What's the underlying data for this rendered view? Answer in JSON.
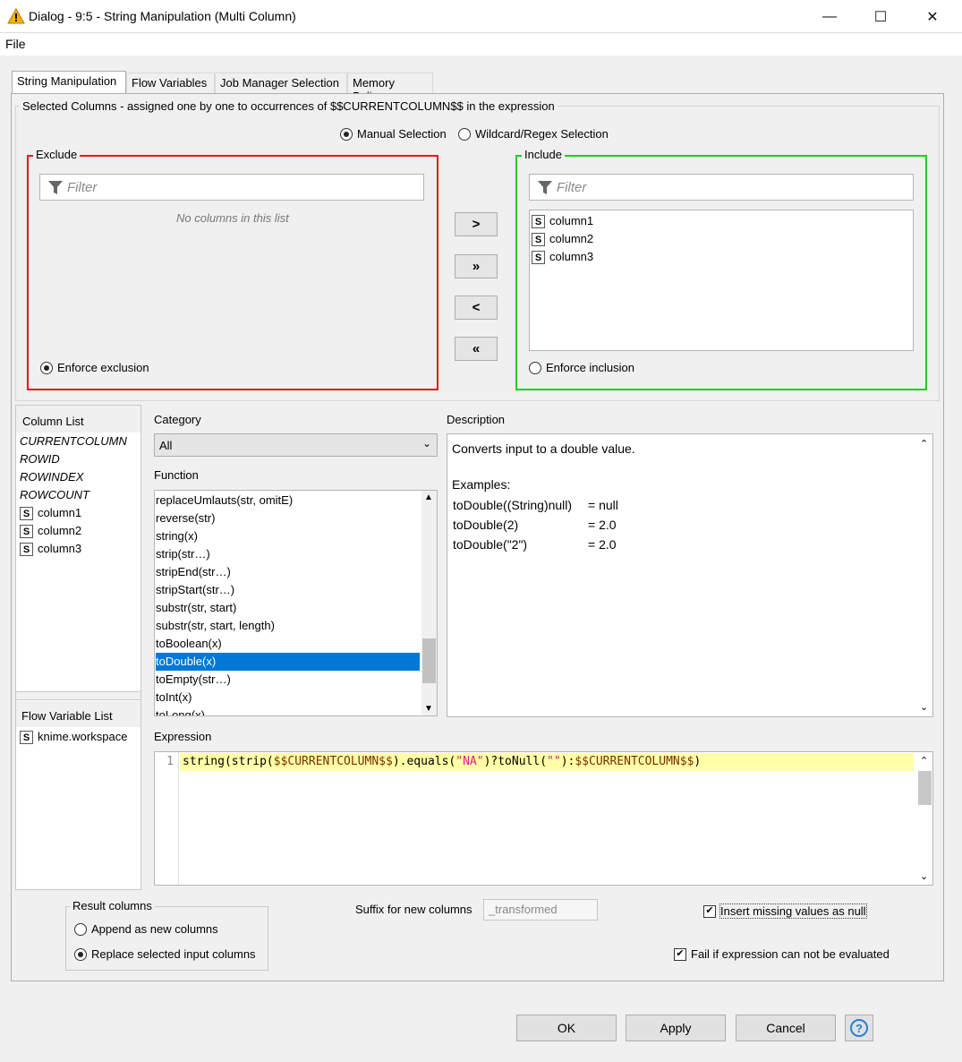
{
  "window": {
    "title": "Dialog - 9:5 - String Manipulation (Multi Column)",
    "min": "—",
    "max": "☐",
    "close": "✕"
  },
  "menu": {
    "file": "File"
  },
  "tabs": [
    "String Manipulation",
    "Flow Variables",
    "Job Manager Selection",
    "Memory Policy"
  ],
  "selected_columns": {
    "legend": "Selected Columns - assigned one by one to occurrences of $$CURRENTCOLUMN$$ in the expression",
    "manual": "Manual Selection",
    "wildcard": "Wildcard/Regex Selection",
    "exclude": {
      "title": "Exclude",
      "filter_placeholder": "Filter",
      "empty": "No columns in this list",
      "enforce": "Enforce exclusion",
      "color": "#e11b1b"
    },
    "include": {
      "title": "Include",
      "filter_placeholder": "Filter",
      "items": [
        "column1",
        "column2",
        "column3"
      ],
      "enforce": "Enforce inclusion",
      "color": "#22cc22"
    },
    "buttons": {
      "add": ">",
      "add_all": "»",
      "remove": "<",
      "remove_all": "«"
    }
  },
  "column_list": {
    "title": "Column List",
    "special": [
      "CURRENTCOLUMN",
      "ROWID",
      "ROWINDEX",
      "ROWCOUNT"
    ],
    "columns": [
      "column1",
      "column2",
      "column3"
    ],
    "type_icon": "S"
  },
  "flow_list": {
    "title": "Flow Variable List",
    "items": [
      "knime.workspace"
    ]
  },
  "category": {
    "label": "Category",
    "value": "All"
  },
  "function": {
    "label": "Function",
    "items": [
      "replaceUmlauts(str, omitE)",
      "reverse(str)",
      "string(x)",
      "strip(str…)",
      "stripEnd(str…)",
      "stripStart(str…)",
      "substr(str, start)",
      "substr(str, start, length)",
      "toBoolean(x)",
      "toDouble(x)",
      "toEmpty(str…)",
      "toInt(x)",
      "toLong(x)"
    ],
    "selected": "toDouble(x)"
  },
  "description": {
    "label": "Description",
    "line1": "Converts input to a double value.",
    "examples": "Examples:",
    "ex": [
      [
        "toDouble((String)null)",
        "= null"
      ],
      [
        "toDouble(2)",
        "= 2.0"
      ],
      [
        "toDouble(\"2\")",
        "= 2.0"
      ]
    ]
  },
  "expression": {
    "label": "Expression",
    "line_no": "1",
    "p1": "string(strip(",
    "v1": "$$CURRENTCOLUMN$$",
    "p2": ").equals(",
    "s1": "\"NA\"",
    "p3": ")?toNull(",
    "s2": "\"\"",
    "p4": "):",
    "v2": "$$CURRENTCOLUMN$$",
    "p5": ")"
  },
  "result": {
    "legend": "Result columns",
    "append": "Append as new columns",
    "replace": "Replace selected input columns"
  },
  "suffix": {
    "label": "Suffix for new columns",
    "value": "_transformed"
  },
  "insert_missing": "Insert missing values as null",
  "fail_if": "Fail if expression can not be evaluated",
  "footer": {
    "ok": "OK",
    "apply": "Apply",
    "cancel": "Cancel",
    "help": "?"
  },
  "colors": {
    "selection": "#0078d7",
    "expr_highlight": "#ffffa8",
    "string_literal": "#d81b8f",
    "variable": "#7a2e00"
  }
}
